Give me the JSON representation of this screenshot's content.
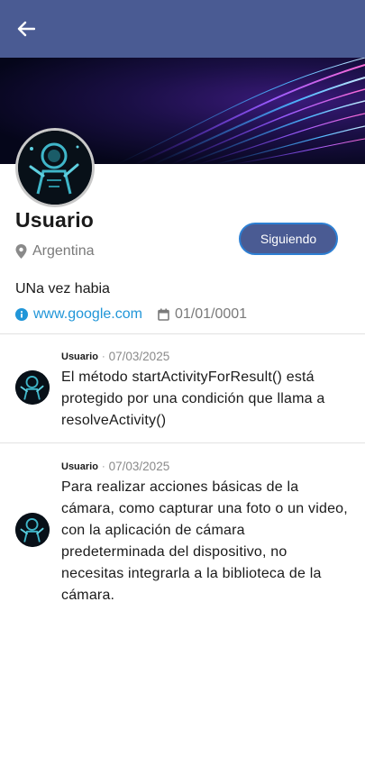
{
  "appbar": {
    "back_icon": "arrow-back-icon"
  },
  "profile": {
    "name": "Usuario",
    "location": "Argentina",
    "follow_label": "Siguiendo",
    "bio": "UNa vez habia",
    "website": "www.google.com",
    "date": "01/01/0001"
  },
  "posts": [
    {
      "user": "Usuario",
      "separator": "·",
      "date": "07/03/2025",
      "text": "El método startActivityForResult() está protegido por una condición que llama a resolveActivity()"
    },
    {
      "user": "Usuario",
      "separator": "·",
      "date": "07/03/2025",
      "text": "Para realizar acciones básicas de la cámara, como capturar una foto o un video, con la aplicación de cámara predeterminada del dispositivo, no necesitas integrarla a la biblioteca de la cámara."
    }
  ],
  "colors": {
    "appbar": "#4a5b93",
    "link": "#2196d8",
    "follow_border": "#2d7fd3"
  }
}
